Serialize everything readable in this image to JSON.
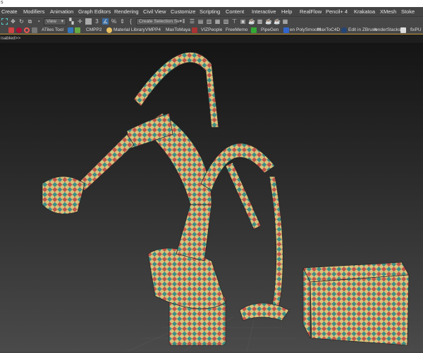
{
  "title": "s",
  "menu": [
    "Create",
    "Modifiers",
    "Animation",
    "Graph Editors",
    "Rendering",
    "Civil View",
    "Customize",
    "Scripting",
    "Content",
    "Interactive",
    "Help",
    "RealFlow",
    "Pencil+ 4",
    "Krakatoa",
    "XMesh",
    "Stoke"
  ],
  "toolbar": {
    "view_dropdown": "View",
    "selection_set": "Create Selection Se"
  },
  "plugins": [
    "ATiles Tool",
    "CMPP2",
    "Material Library",
    "VMPP4",
    "MaxToMaya",
    "VIZPeople",
    "FreeMemo",
    "PipeGen",
    "en PolySmooth",
    "MaxToC4D",
    "Edit in ZBrush",
    "renderStacks",
    "fixPU"
  ],
  "status": "isabled>>",
  "colors": {
    "accent": "#c89a3a",
    "checker": [
      "#d9c27a",
      "#c2544a",
      "#3f8f84",
      "#e6d59a"
    ]
  }
}
